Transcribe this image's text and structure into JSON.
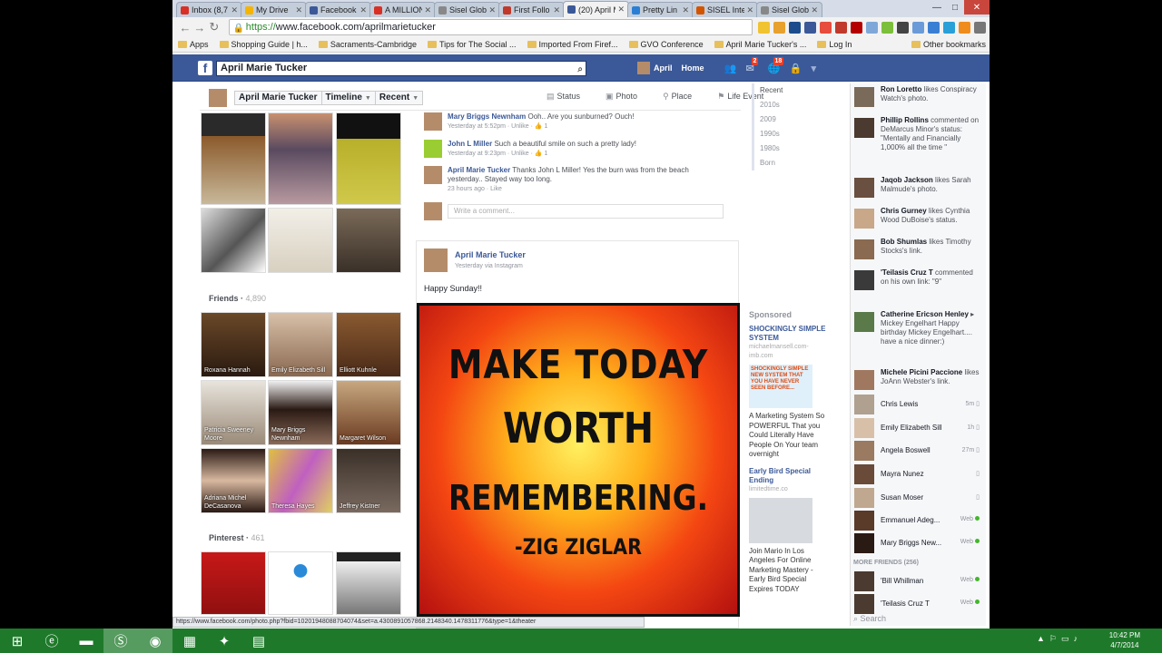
{
  "browser": {
    "tabs": [
      {
        "label": "Inbox (8,7",
        "color": "#d93025",
        "active": false
      },
      {
        "label": "My Drive",
        "color": "#f4b400",
        "active": false
      },
      {
        "label": "Facebook",
        "color": "#3b5998",
        "active": false
      },
      {
        "label": "A MILLION",
        "color": "#d93025",
        "active": false
      },
      {
        "label": "Sisel Globa",
        "color": "#888888",
        "active": false
      },
      {
        "label": "First Follo",
        "color": "#c0392b",
        "active": false
      },
      {
        "label": "(20) April M",
        "color": "#3b5998",
        "active": true
      },
      {
        "label": "Pretty Lin",
        "color": "#2a7fd4",
        "active": false
      },
      {
        "label": "SISEL Inter",
        "color": "#d35400",
        "active": false
      },
      {
        "label": "Sisel Globa",
        "color": "#888888",
        "active": false
      }
    ],
    "url_scheme": "https://",
    "url_rest": "www.facebook.com/aprilmarietucker",
    "bookmarks": [
      "Apps",
      "Shopping Guide | h...",
      "Sacraments-Cambridge",
      "Tips for The Social ...",
      "Imported From Firef...",
      "GVO Conference",
      "April Marie Tucker's ...",
      "Log In",
      "Other bookmarks"
    ],
    "status_url": "https://www.facebook.com/photo.php?fbid=10201948088704074&set=a.4300891057868.2148340.1478311776&type=1&theater"
  },
  "fb": {
    "search_value": "April Marie Tucker",
    "user": "April",
    "home": "Home",
    "friend_badge": "",
    "msg_badge": "2",
    "notif_badge": "18"
  },
  "timeline": {
    "name_btn": "April Marie Tucker",
    "timeline_btn": "Timeline",
    "recent_btn": "Recent",
    "actions": [
      "Status",
      "Photo",
      "Place",
      "Life Event"
    ]
  },
  "friends": {
    "header": "Friends",
    "count": "4,890",
    "list": [
      "Roxana Hannah",
      "Emily Elizabeth Sill",
      "Elliott Kuhnle",
      "Patricia Sweeney Moore",
      "Mary Briggs Newnham",
      "Margaret Wilson",
      "Adriana Michel DeCasanova",
      "Theresa Hayes",
      "Jeffrey Kistner"
    ]
  },
  "pinterest": {
    "header": "Pinterest",
    "count": "461"
  },
  "comments": [
    {
      "name": "Mary Briggs Newnham",
      "text": "Ooh.. Are you sunburned? Ouch!",
      "meta": "Yesterday at 5:52pm · Unlike · 👍 1"
    },
    {
      "name": "John L Miller",
      "text": "Such a beautiful smile on such a pretty lady!",
      "meta": "Yesterday at 9:23pm · Unlike · 👍 1"
    },
    {
      "name": "April Marie Tucker",
      "text": "Thanks John L Miller! Yes the burn was from the beach yesterday.. Stayed way too long.",
      "meta": "23 hours ago · Like"
    }
  ],
  "write_comment": "Write a comment...",
  "post": {
    "author": "April Marie Tucker",
    "meta": "Yesterday via Instagram",
    "text": "Happy Sunday!!",
    "image_lines": [
      "MAKE TODAY",
      "WORTH",
      "REMEMBERING.",
      "-ZIG ZIGLAR"
    ]
  },
  "ticker_years": [
    "Recent",
    "2010s",
    "2009",
    "1990s",
    "1980s",
    "Born"
  ],
  "sponsored": {
    "header": "Sponsored",
    "ads": [
      {
        "title": "SHOCKINGLY SIMPLE SYSTEM",
        "domain": "michaelmansell.com-imb.com",
        "img_text": "SHOCKINGLY SIMPLE NEW SYSTEM THAT YOU HAVE NEVER SEEN BEFORE...",
        "body": "A Marketing System So POWERFUL That you Could Literally Have People On Your team overnight"
      },
      {
        "title": "Early Bird Special Ending",
        "domain": "limitedtime.co",
        "img_text": "",
        "body": "Join Mario In Los Angeles For Online Marketing Mastery - Early Bird Special Expires TODAY"
      }
    ]
  },
  "activity": [
    {
      "name": "Ron Loretto",
      "text": "likes Conspiracy Watch's photo."
    },
    {
      "name": "Phillip Rollins",
      "text": "commented on DeMarcus Minor's status: \"Mentally and Financially 1,000% all the time \""
    },
    {
      "name": "Jaqob Jackson",
      "text": "likes Sarah Malmude's photo."
    },
    {
      "name": "Chris Gurney",
      "text": "likes Cynthia Wood DuBoise's status."
    },
    {
      "name": "Bob Shumlas",
      "text": "likes Timothy Stocks's link."
    },
    {
      "name": "'Teilasis Cruz T",
      "text": "commented on his own link: \"9\""
    },
    {
      "name": "Catherine Ericson Henley",
      "text": "▸ Mickey Engelhart Happy birthday Mickey Engelhart.... have a nice dinner:)"
    },
    {
      "name": "Michele Picini Paccione",
      "text": "likes JoAnn Webster's link."
    }
  ],
  "chat": [
    {
      "name": "Chris Lewis",
      "status": "5m"
    },
    {
      "name": "Emily Elizabeth Sill",
      "status": "1h"
    },
    {
      "name": "Angela Boswell",
      "status": "27m"
    },
    {
      "name": "Mayra Nunez",
      "status": ""
    },
    {
      "name": "Susan Moser",
      "status": ""
    },
    {
      "name": "Emmanuel Adeg...",
      "status": "Web"
    },
    {
      "name": "Mary Briggs New...",
      "status": "Web"
    }
  ],
  "more_friends": "MORE FRIENDS (256)",
  "chat_more": [
    {
      "name": "'Bill Whillman",
      "status": "Web"
    },
    {
      "name": "'Teilasis Cruz T",
      "status": "Web"
    }
  ],
  "chat_search": "Search",
  "taskbar": {
    "time": "10:42 PM",
    "date": "4/7/2014"
  }
}
